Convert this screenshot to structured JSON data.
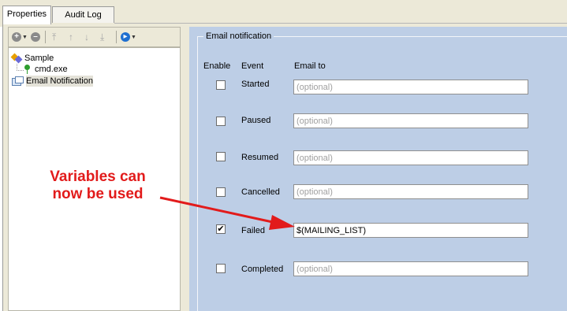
{
  "tabs": [
    {
      "label": "Properties"
    },
    {
      "label": "Audit Log"
    }
  ],
  "toolbar": {
    "icons": [
      "add-icon",
      "remove-icon",
      "move-top-icon",
      "move-up-icon",
      "move-down-icon",
      "move-bottom-icon",
      "run-icon"
    ]
  },
  "tree": {
    "items": [
      {
        "label": "Sample",
        "icon": "sample-icon"
      },
      {
        "label": "cmd.exe",
        "icon": "pin-icon"
      },
      {
        "label": "Email Notification",
        "icon": "mail-icon"
      }
    ]
  },
  "email": {
    "group_title": "Email notification",
    "headers": {
      "enable": "Enable",
      "event": "Event",
      "email_to": "Email to"
    },
    "rows": [
      {
        "event": "Started",
        "checked": false,
        "value": "",
        "placeholder": "(optional)"
      },
      {
        "event": "Paused",
        "checked": false,
        "value": "",
        "placeholder": "(optional)"
      },
      {
        "event": "Resumed",
        "checked": false,
        "value": "",
        "placeholder": "(optional)"
      },
      {
        "event": "Cancelled",
        "checked": false,
        "value": "",
        "placeholder": "(optional)"
      },
      {
        "event": "Failed",
        "checked": true,
        "value": "$(MAILING_LIST)",
        "placeholder": "(optional)"
      },
      {
        "event": "Completed",
        "checked": false,
        "value": "",
        "placeholder": "(optional)"
      }
    ],
    "check_mark": "✔"
  },
  "annotation": {
    "line1": "Variables can",
    "line2": "now be used",
    "color": "#e21b1b"
  }
}
